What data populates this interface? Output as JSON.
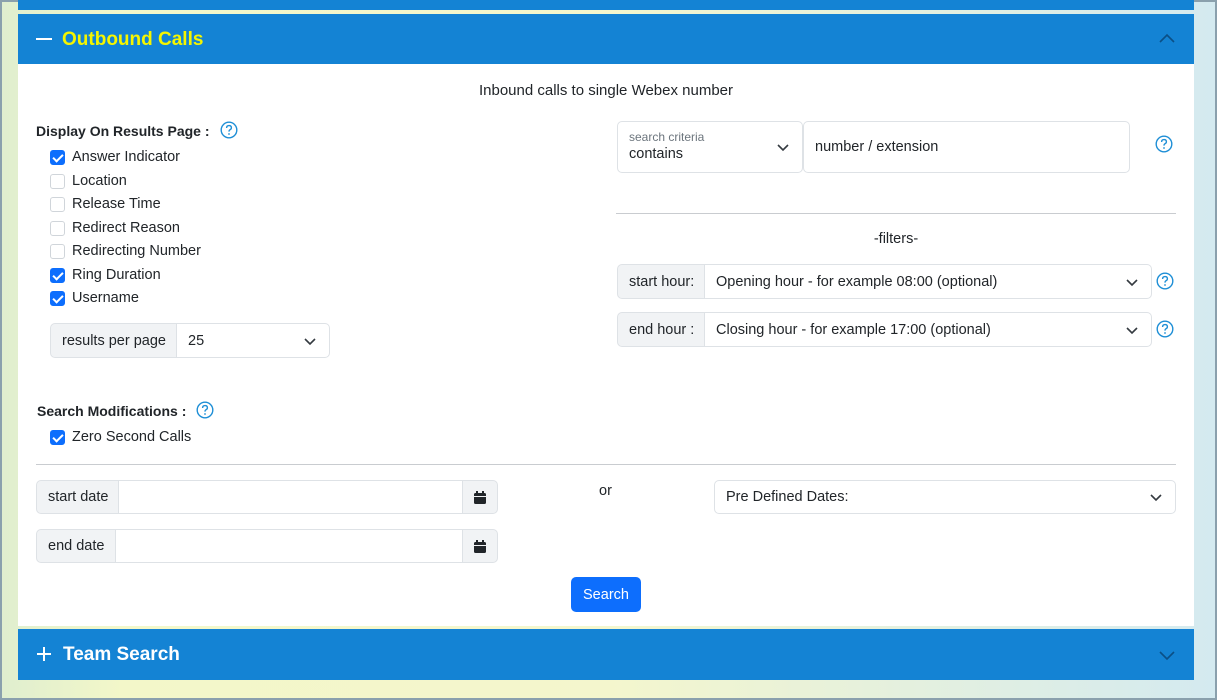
{
  "outbound": {
    "title": "Outbound Calls",
    "subtitle": "Inbound calls to single Webex number"
  },
  "display": {
    "label": "Display On Results Page :",
    "options": [
      {
        "label": "Answer Indicator",
        "checked": true
      },
      {
        "label": "Location",
        "checked": false
      },
      {
        "label": "Release Time",
        "checked": false
      },
      {
        "label": "Redirect Reason",
        "checked": false
      },
      {
        "label": "Redirecting Number",
        "checked": false
      },
      {
        "label": "Ring Duration",
        "checked": true
      },
      {
        "label": "Username",
        "checked": true
      }
    ],
    "results_per_page_label": "results per page",
    "results_per_page_value": "25"
  },
  "criteria": {
    "float_label": "search criteria",
    "value": "contains",
    "number_value": "number / extension"
  },
  "filters": {
    "label": "-filters-",
    "start_hour_label": "start hour:",
    "start_hour_value": "Opening hour - for example 08:00 (optional)",
    "end_hour_label": "end hour :",
    "end_hour_value": "Closing hour - for example 17:00 (optional)"
  },
  "modifications": {
    "label": "Search Modifications :",
    "options": [
      {
        "label": "Zero Second Calls",
        "checked": true
      }
    ]
  },
  "dates": {
    "start_label": "start date",
    "end_label": "end date",
    "or_label": "or",
    "predefined_value": "Pre Defined Dates:"
  },
  "search_button": "Search",
  "team": {
    "title": "Team Search"
  },
  "colors": {
    "header_blue": "#1483d4",
    "title_yellow": "#f5f500",
    "primary": "#0d6efd",
    "help_icon": "#1f8fd6"
  }
}
